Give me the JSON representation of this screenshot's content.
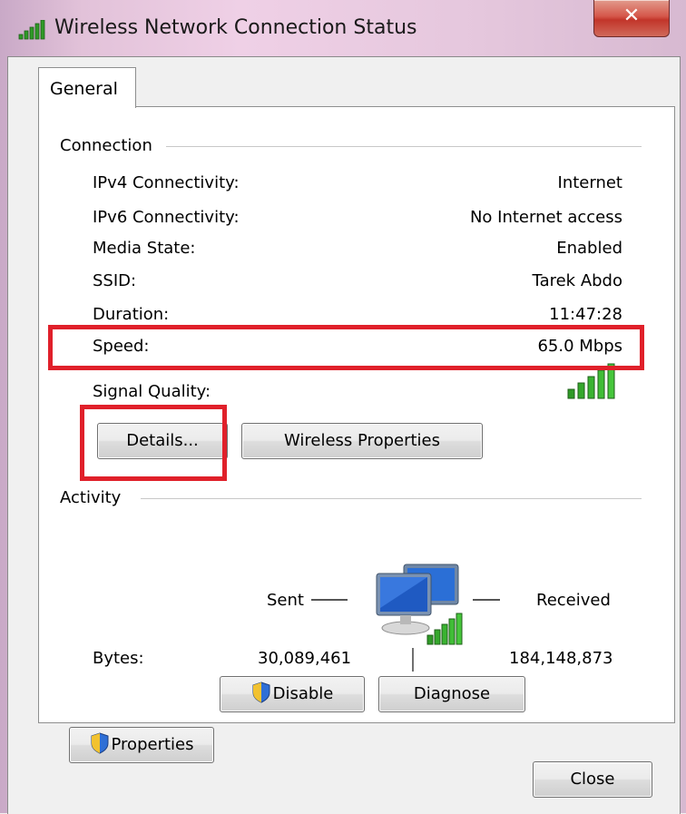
{
  "window": {
    "title": "Wireless Network Connection Status"
  },
  "tabs": [
    {
      "label": "General"
    }
  ],
  "connection": {
    "group_label": "Connection",
    "rows": [
      {
        "label": "IPv4 Connectivity:",
        "value": "Internet"
      },
      {
        "label": "IPv6 Connectivity:",
        "value": "No Internet access"
      },
      {
        "label": "Media State:",
        "value": "Enabled"
      },
      {
        "label": "SSID:",
        "value": "Tarek Abdo"
      },
      {
        "label": "Duration:",
        "value": "11:47:28"
      },
      {
        "label": "Speed:",
        "value": "65.0 Mbps"
      },
      {
        "label": "Signal Quality:",
        "value": ""
      }
    ],
    "signal_bars": 5,
    "details_button": "Details...",
    "wireless_properties_button": "Wireless Properties"
  },
  "activity": {
    "group_label": "Activity",
    "sent_label": "Sent",
    "received_label": "Received",
    "bytes_label": "Bytes:",
    "bytes_sent": "30,089,461",
    "bytes_received": "184,148,873"
  },
  "buttons": {
    "properties": "Properties",
    "disable": "Disable",
    "diagnose": "Diagnose",
    "close": "Close"
  },
  "colors": {
    "highlight": "#e0202a",
    "signal_green": "#2f9a27",
    "close_button_red": "#c2352a"
  },
  "icons": [
    "signal-strength-icon",
    "close-icon",
    "shield-icon",
    "network-computers-icon"
  ]
}
